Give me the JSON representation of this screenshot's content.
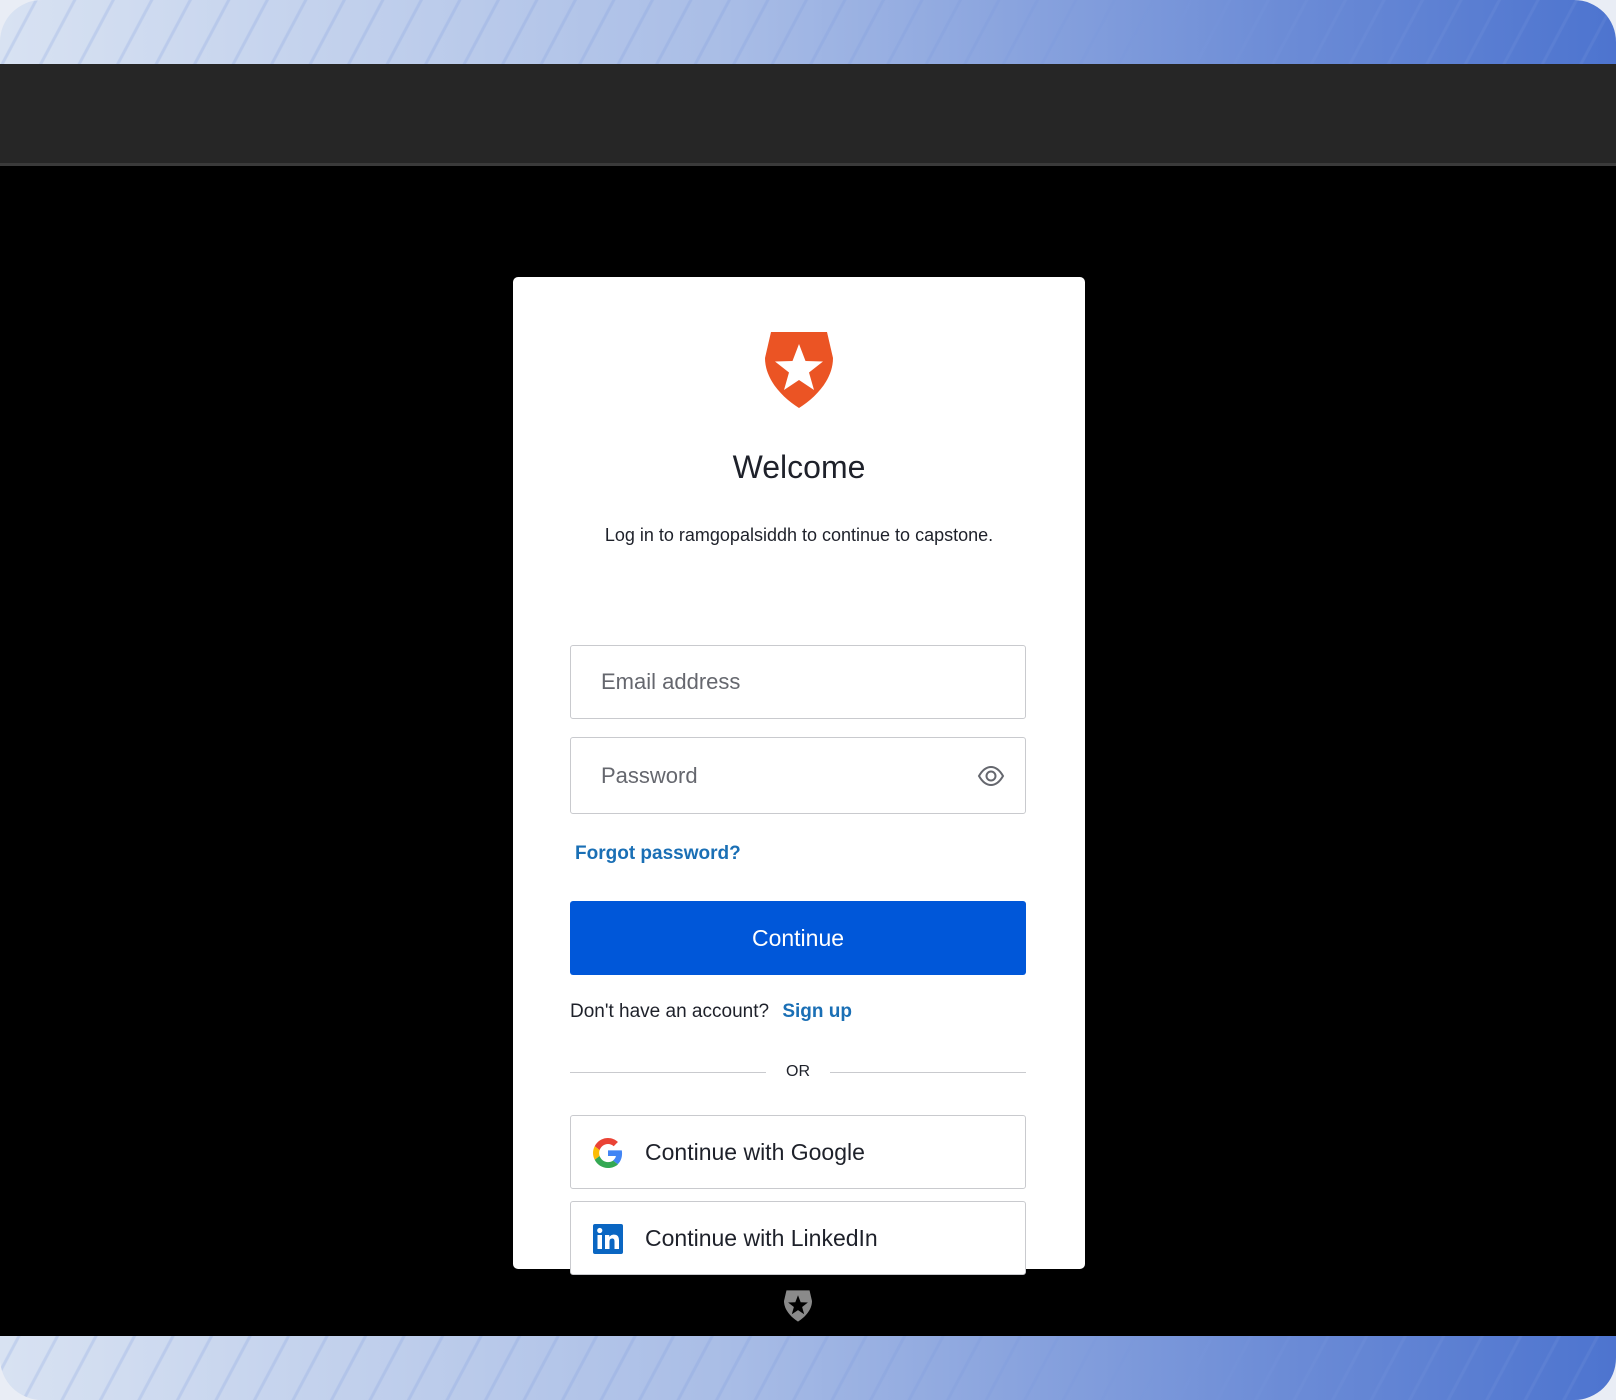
{
  "login": {
    "title": "Welcome",
    "subtitle": "Log in to ramgopalsiddh to continue to capstone.",
    "email_placeholder": "Email address",
    "password_placeholder": "Password",
    "forgot_password": "Forgot password?",
    "continue_label": "Continue",
    "no_account_text": "Don't have an account?",
    "signup_link": "Sign up",
    "or_text": "OR",
    "google_label": "Continue with Google",
    "linkedin_label": "Continue with LinkedIn"
  },
  "icons": {
    "logo": "auth0-shield-star-icon",
    "password_toggle": "eye-icon",
    "google": "google-icon",
    "linkedin": "linkedin-icon",
    "footer": "auth0-shield-star-icon"
  },
  "colors": {
    "brand": "#eb5424",
    "primary_button": "#0057d9",
    "link": "#1a6fb5",
    "linkedin": "#0a66c2"
  }
}
